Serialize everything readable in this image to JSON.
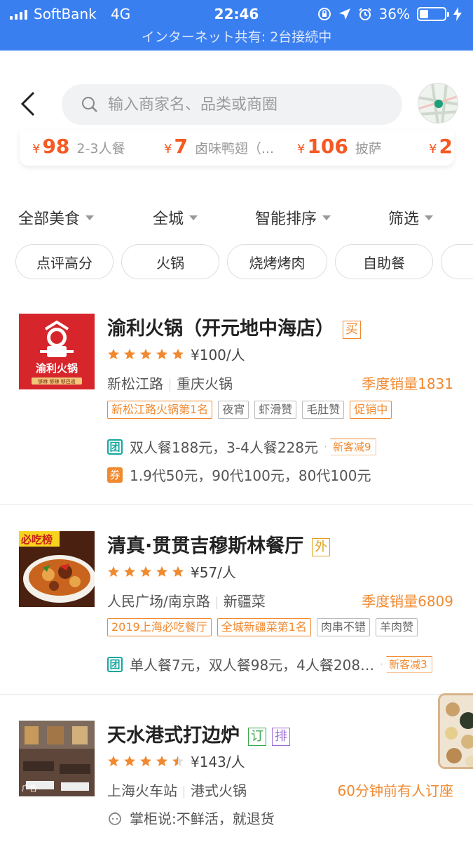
{
  "status_bar": {
    "carrier": "SoftBank",
    "network": "4G",
    "time": "22:46",
    "battery": "36%",
    "battery_level": 0.36,
    "hotspot": "インターネット共有: 2台接続中"
  },
  "search": {
    "placeholder": "输入商家名、品类或商圈"
  },
  "deals": [
    {
      "currency": "¥",
      "price": "98",
      "name": "2-3人餐"
    },
    {
      "currency": "¥",
      "price": "7",
      "name": "卤味鸭翅（..."
    },
    {
      "currency": "¥",
      "price": "106",
      "name": "披萨"
    },
    {
      "currency": "¥",
      "price": "2",
      "name": ""
    }
  ],
  "filters": [
    "全部美食",
    "全城",
    "智能排序",
    "筛选"
  ],
  "quick_tags": [
    "点评高分",
    "火锅",
    "烧烤烤肉",
    "自助餐"
  ],
  "colors": {
    "accent": "#f0892f",
    "brand_blue": "#3a7ff0",
    "price_red": "#f45a23"
  },
  "restaurants": [
    {
      "name": "渝利火锅（开元地中海店）",
      "badges": [
        {
          "text": "买",
          "style": "orange"
        }
      ],
      "rating": 5,
      "avg_price": "¥100/人",
      "district": "新松江路",
      "cuisine": "重庆火锅",
      "sales": "季度销量1831",
      "labels": [
        {
          "text": "新松江路火锅第1名",
          "hl": true
        },
        {
          "text": "夜宵",
          "hl": false
        },
        {
          "text": "虾滑赞",
          "hl": false
        },
        {
          "text": "毛肚赞",
          "hl": false
        },
        {
          "text": "促销中",
          "hl": true
        }
      ],
      "thumb_text": "渝利火锅",
      "thumb_sub": "够麻 够辣 够巴适",
      "offers": [
        {
          "icon": "团",
          "type": "tuan",
          "text": "双人餐188元，3-4人餐228元",
          "tag": "新客减9"
        },
        {
          "icon": "券",
          "type": "quan",
          "text": "1.9代50元，90代100元，80代100元",
          "tag": ""
        }
      ]
    },
    {
      "name": "清真·贯贯吉穆斯林餐厅",
      "badges": [
        {
          "text": "外",
          "style": "yellow"
        }
      ],
      "rating": 5,
      "avg_price": "¥57/人",
      "district": "人民广场/南京路",
      "cuisine": "新疆菜",
      "sales": "季度销量6809",
      "labels": [
        {
          "text": "2019上海必吃餐厅",
          "hl": true
        },
        {
          "text": "全城新疆菜第1名",
          "hl": true
        },
        {
          "text": "肉串不错",
          "hl": false
        },
        {
          "text": "羊肉赞",
          "hl": false
        }
      ],
      "thumb_text": "必吃榜",
      "offers": [
        {
          "icon": "团",
          "type": "tuan",
          "text": "单人餐7元，双人餐98元，4人餐208…",
          "tag": "新客减3"
        }
      ]
    },
    {
      "name": "天水港式打边炉",
      "badges": [
        {
          "text": "订",
          "style": "green"
        },
        {
          "text": "排",
          "style": "purple"
        }
      ],
      "rating": 4.5,
      "avg_price": "¥143/人",
      "district": "上海火车站",
      "cuisine": "港式火锅",
      "recent": "60分钟前有人订座",
      "thumb_text": "广告",
      "quote": "掌柜说:不鲜活，就退货"
    }
  ]
}
